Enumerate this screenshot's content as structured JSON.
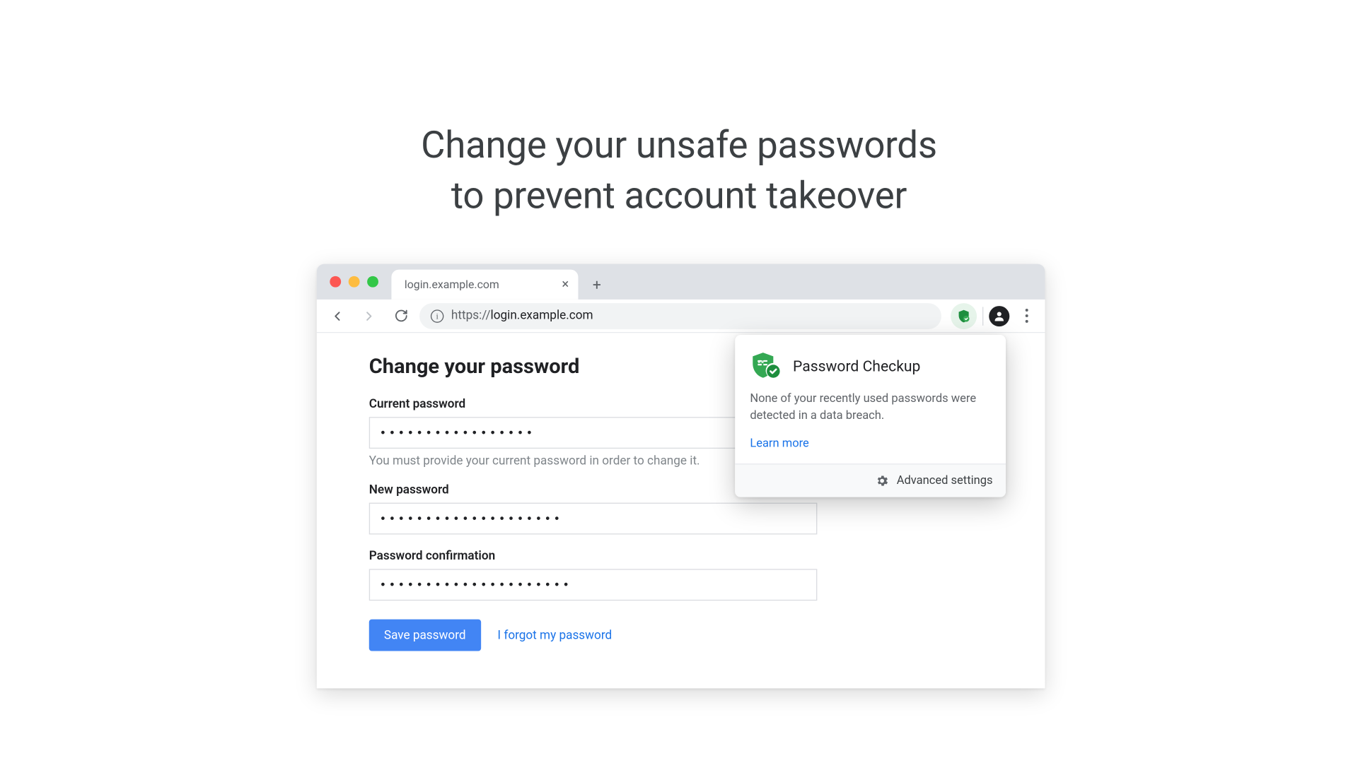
{
  "headline": {
    "line1": "Change your unsafe passwords",
    "line2": "to prevent account takeover"
  },
  "browser": {
    "tab_title": "login.example.com",
    "tab_close": "×",
    "new_tab": "+",
    "url_proto": "https://",
    "url_host": "login.example.com",
    "back": "←",
    "forward": "→",
    "reload": "⟳",
    "info": "i"
  },
  "page": {
    "heading": "Change your password",
    "current_label": "Current password",
    "current_value": "•••••••••••••••••",
    "hint": "You must provide your current password in order to change it.",
    "new_label": "New password",
    "new_value": "••••••••••••••••••••",
    "confirm_label": "Password confirmation",
    "confirm_value": "•••••••••••••••••••••",
    "save_label": "Save password",
    "forgot_label": "I forgot my password"
  },
  "popover": {
    "title": "Password Checkup",
    "body": "None of your recently used passwords were detected in a data breach.",
    "learn_more": "Learn more",
    "advanced": "Advanced settings"
  }
}
